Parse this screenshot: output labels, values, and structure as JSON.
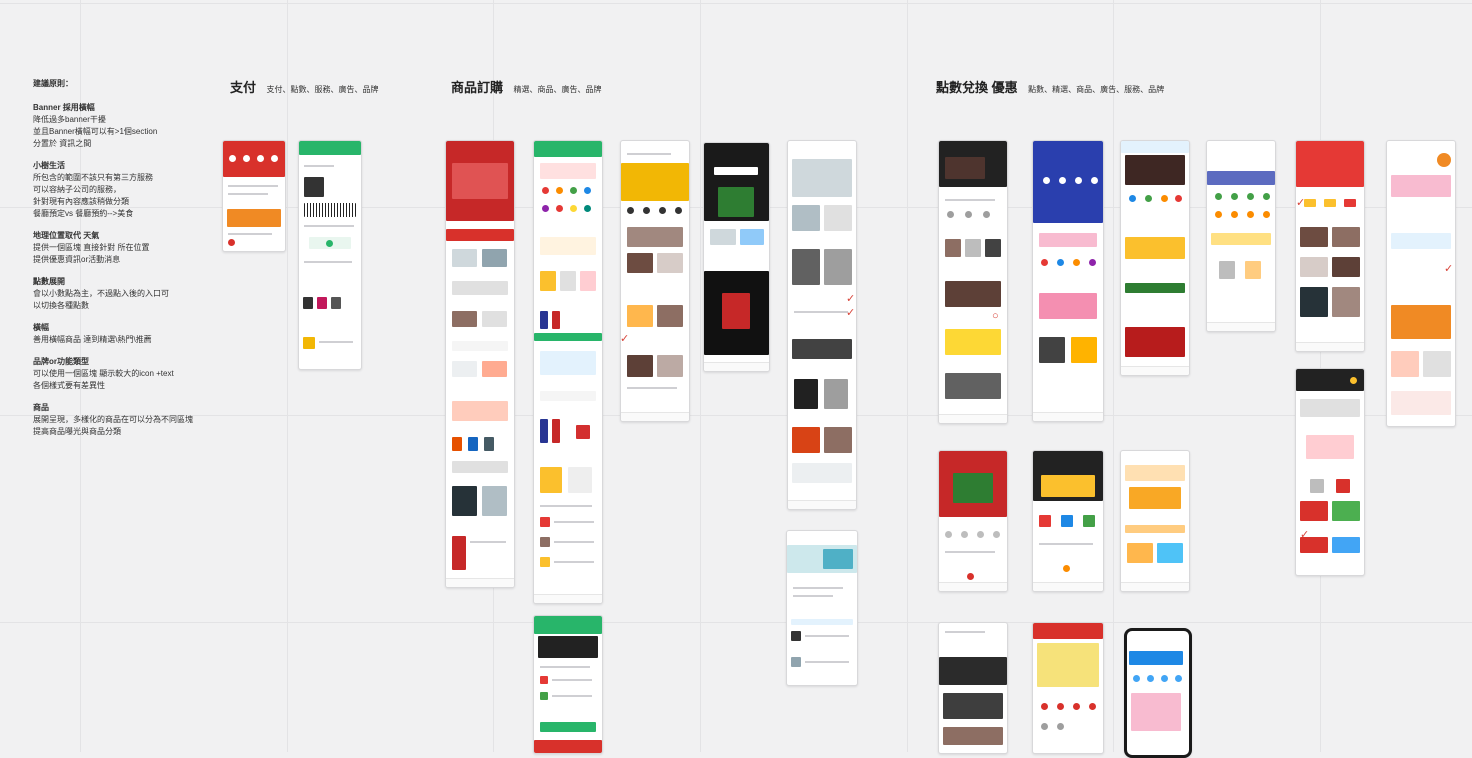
{
  "notes": {
    "title": "建議原則：",
    "sections": [
      {
        "heading": "Banner 採用橫幅",
        "lines": [
          "降低過多banner干擾",
          "並且Banner橫幅可以有>1個section",
          "分置於 資訊之間"
        ]
      },
      {
        "heading": "小樹生活",
        "lines": [
          "所包含的範圍不該只有第三方服務",
          "可以容納子公司的服務，",
          "針對現有內容應該稍做分類",
          "餐廳預定vs 餐廳預約-->美食"
        ]
      },
      {
        "heading": "地理位置取代 天氣",
        "lines": [
          "提供一個區塊 直接針對 所在位置",
          "提供優惠資訊or活動消息"
        ]
      },
      {
        "heading": "點數展開",
        "lines": [
          "會以小數點為主，不過點入後的入口可",
          "以切換各種點數"
        ]
      },
      {
        "heading": "橫幅",
        "lines": [
          "善用橫幅商品 達到精選\\熱門\\推薦"
        ]
      },
      {
        "heading": "品牌or功能類型",
        "lines": [
          "可以使用一個區塊 顯示較大的icon +text",
          "各個樣式要有差異性"
        ]
      },
      {
        "heading": "商品",
        "lines": [
          "展開呈現，多樣化的商品在可以分為不同區塊",
          "提高商品曝光與商品分類"
        ]
      }
    ]
  },
  "categories": [
    {
      "title": "支付",
      "subtitle": "支付、點數、服務、廣告、品牌"
    },
    {
      "title": "商品訂購",
      "subtitle": "精選、商品、廣告、品牌"
    },
    {
      "title": "點數兌換 優惠",
      "subtitle": "點數、精選、商品、廣告、服務、品牌"
    }
  ],
  "colors": {
    "canvas": "#f1f1f2",
    "red": "#d8312b",
    "green": "#28b56a",
    "dark": "#222222",
    "orange": "#f08a24",
    "blue": "#2a3fae",
    "annotation": "#d8443a"
  }
}
